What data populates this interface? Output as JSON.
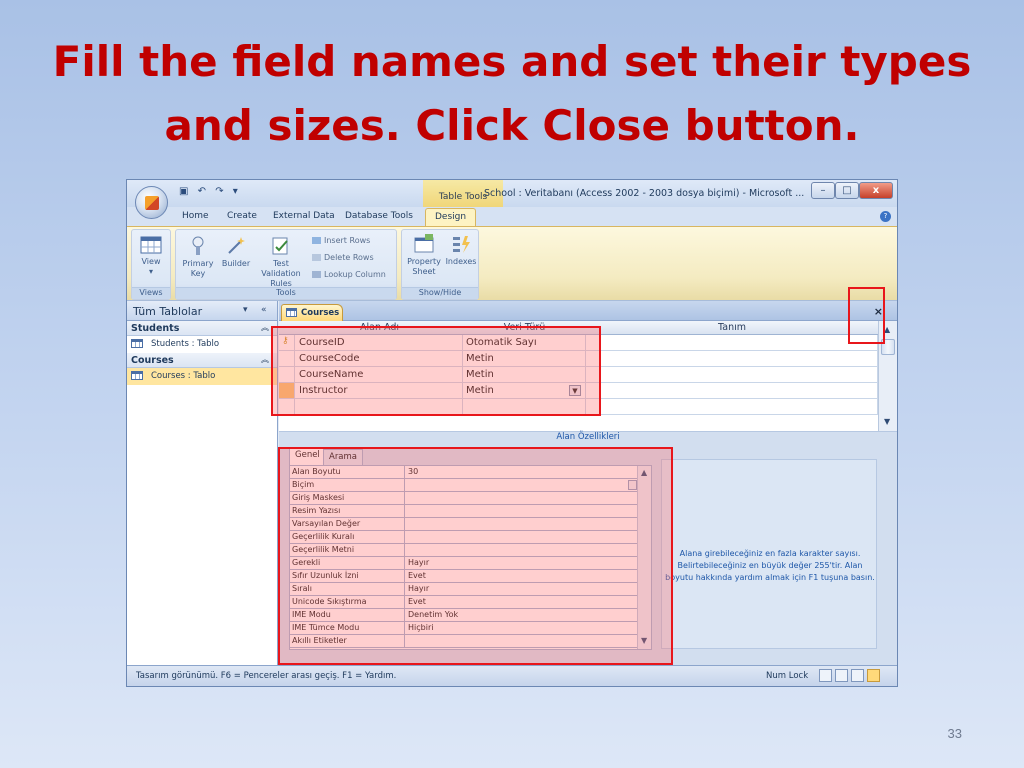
{
  "slide": {
    "title_line1": "Fill the field names and set their types",
    "title_line2": "and sizes. Click Close button.",
    "page_number": "33"
  },
  "window": {
    "title": "School : Veritabanı (Access 2002 - 2003 dosya biçimi) - Microsoft ...",
    "context_tab": "Table Tools",
    "controls": {
      "minimize": "–",
      "maximize": "□",
      "close": "x"
    }
  },
  "ribbon": {
    "tabs": [
      "Home",
      "Create",
      "External Data",
      "Database Tools",
      "Design"
    ],
    "active_tab": "Design",
    "groups": {
      "views": {
        "label": "Views",
        "view": "View"
      },
      "tools": {
        "label": "Tools",
        "primary_key": "Primary Key",
        "builder": "Builder",
        "test_validation": "Test Validation Rules",
        "insert_rows": "Insert Rows",
        "delete_rows": "Delete Rows",
        "lookup_column": "Lookup Column"
      },
      "show_hide": {
        "label": "Show/Hide",
        "property_sheet": "Property Sheet",
        "indexes": "Indexes"
      }
    }
  },
  "nav_pane": {
    "title": "Tüm Tablolar",
    "groups": [
      {
        "name": "Students",
        "items": [
          "Students : Tablo"
        ]
      },
      {
        "name": "Courses",
        "items": [
          "Courses : Tablo"
        ]
      }
    ]
  },
  "document": {
    "tab_label": "Courses",
    "columns": {
      "field_name": "Alan Adı",
      "data_type": "Veri Türü",
      "description": "Tanım"
    },
    "fields": [
      {
        "name": "CourseID",
        "type": "Otomatik Sayı",
        "primary_key": true
      },
      {
        "name": "CourseCode",
        "type": "Metin"
      },
      {
        "name": "CourseName",
        "type": "Metin"
      },
      {
        "name": "Instructor",
        "type": "Metin"
      }
    ],
    "field_properties_caption": "Alan Özellikleri",
    "property_tabs": [
      "Genel",
      "Arama"
    ],
    "active_property_tab": "Genel",
    "properties": [
      {
        "name": "Alan Boyutu",
        "value": "30"
      },
      {
        "name": "Biçim",
        "value": ""
      },
      {
        "name": "Giriş Maskesi",
        "value": ""
      },
      {
        "name": "Resim Yazısı",
        "value": ""
      },
      {
        "name": "Varsayılan Değer",
        "value": ""
      },
      {
        "name": "Geçerlilik Kuralı",
        "value": ""
      },
      {
        "name": "Geçerlilik Metni",
        "value": ""
      },
      {
        "name": "Gerekli",
        "value": "Hayır"
      },
      {
        "name": "Sıfır Uzunluk İzni",
        "value": "Evet"
      },
      {
        "name": "Sıralı",
        "value": "Hayır"
      },
      {
        "name": "Unicode Sıkıştırma",
        "value": "Evet"
      },
      {
        "name": "IME Modu",
        "value": "Denetim Yok"
      },
      {
        "name": "IME Tümce Modu",
        "value": "Hiçbiri"
      },
      {
        "name": "Akıllı Etiketler",
        "value": ""
      }
    ],
    "help_text": [
      "Alana girebileceğiniz en fazla karakter sayısı.",
      "Belirtebileceğiniz en büyük değer 255'tir. Alan",
      "boyutu hakkında yardım almak için F1 tuşuna basın."
    ]
  },
  "statusbar": {
    "left": "Tasarım görünümü.  F6 = Pencereler arası geçiş.  F1 = Yardım.",
    "num_lock": "Num Lock"
  },
  "colors": {
    "title_red": "#c00000",
    "highlight_red": "#e8161b",
    "ribbon_active": "#fdf3c3"
  },
  "icons": [
    "office-button",
    "save-icon",
    "undo-icon",
    "redo-icon",
    "help-icon",
    "key-icon",
    "table-icon",
    "close-icon"
  ]
}
